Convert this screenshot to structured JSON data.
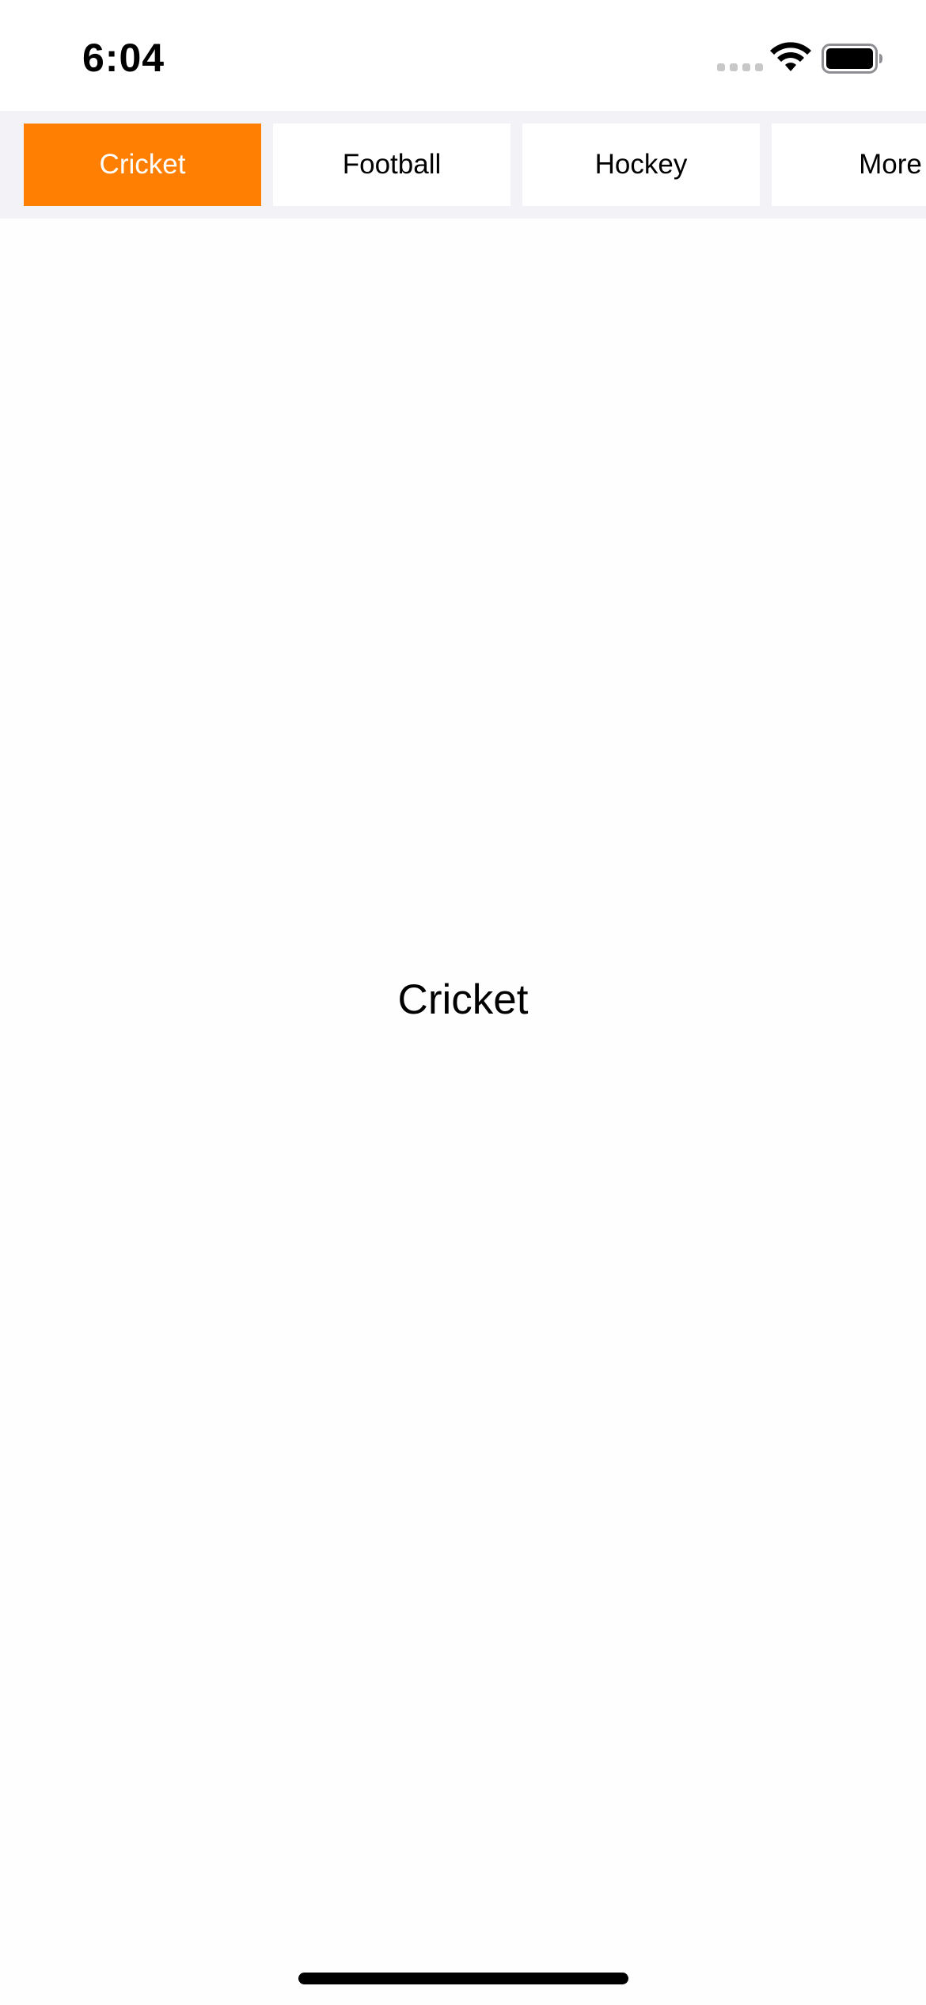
{
  "status_bar": {
    "time": "6:04",
    "signal_icon": "cellular-signal-dots-icon",
    "wifi_icon": "wifi-icon",
    "battery_icon": "battery-icon"
  },
  "tabs": [
    {
      "label": "Cricket",
      "selected": true
    },
    {
      "label": "Football",
      "selected": false
    },
    {
      "label": "Hockey",
      "selected": false
    },
    {
      "label": "More",
      "selected": false
    }
  ],
  "content": {
    "title": "Cricket"
  },
  "colors": {
    "accent": "#fe7f02",
    "tab_bar_background": "#f2f2f7",
    "tab_background": "#ffffff"
  }
}
